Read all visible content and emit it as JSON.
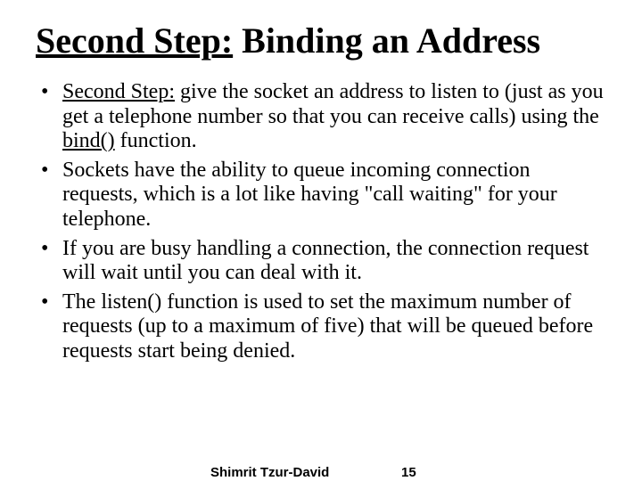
{
  "title": {
    "underlined": "Second Step:",
    "rest": " Binding an Address"
  },
  "bullets": {
    "b1": {
      "prefix": "Second Step:",
      "text1": " give the socket an address to listen to (just as you get a telephone number so that you can receive calls) using the ",
      "fn": "bind()",
      "text2": " function."
    },
    "b2": "Sockets have the ability to queue incoming connection requests, which is a lot like having \"call waiting\" for your telephone.",
    "b3": "If you are busy handling a connection, the connection request will wait until you can deal with it.",
    "b4": "The listen() function is used to set the maximum number of requests (up to a maximum of five) that will be queued before requests start being denied."
  },
  "footer": {
    "author": "Shimrit Tzur-David",
    "page": "15"
  }
}
